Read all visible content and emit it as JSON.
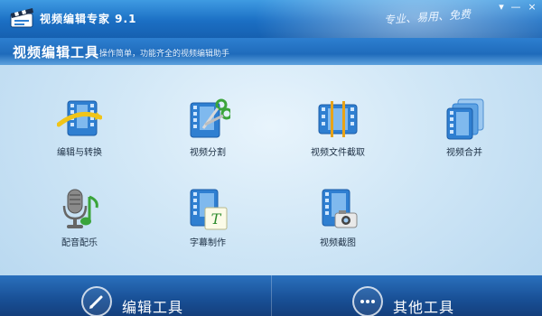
{
  "window": {
    "title": "视频编辑专家 9.1",
    "slogan": "专业、易用、免费",
    "controls": {
      "settings": "▾",
      "minimize": "—",
      "close": "×"
    }
  },
  "header": {
    "title": "视频编辑工具",
    "subtitle": "操作简单，功能齐全的视频编辑助手"
  },
  "tools": [
    {
      "label": "编辑与转换",
      "icon": "film-edit-convert-icon"
    },
    {
      "label": "视频分割",
      "icon": "film-scissors-icon"
    },
    {
      "label": "视频文件截取",
      "icon": "film-cut-markers-icon"
    },
    {
      "label": "视频合并",
      "icon": "film-stack-merge-icon"
    },
    {
      "label": "配音配乐",
      "icon": "microphone-music-icon"
    },
    {
      "label": "字幕制作",
      "icon": "subtitle-text-icon"
    },
    {
      "label": "视频截图",
      "icon": "film-camera-icon"
    }
  ],
  "bottom_tabs": [
    {
      "label": "编辑工具",
      "icon": "pencil-icon",
      "active": true
    },
    {
      "label": "其他工具",
      "icon": "more-dots-icon",
      "active": false
    }
  ],
  "colors": {
    "accent": "#1f6bbb",
    "background": "#cfe6f6",
    "film": "#2f7fd1"
  }
}
